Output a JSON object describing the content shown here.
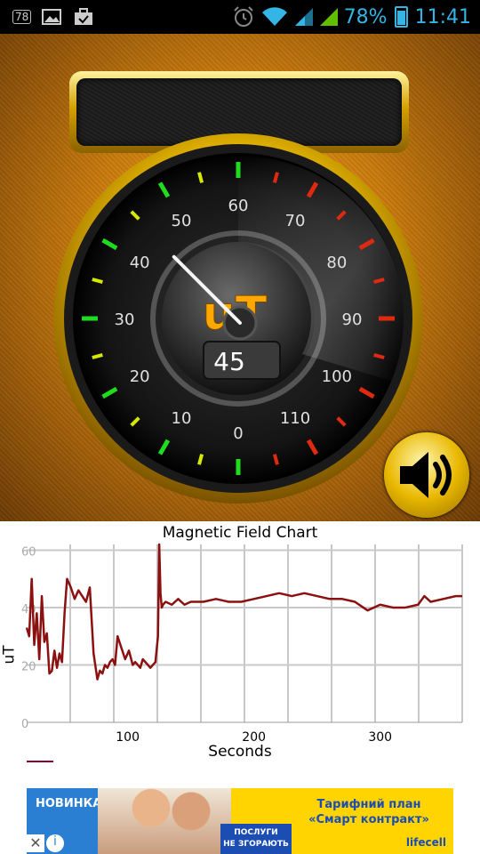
{
  "status_bar": {
    "notification_badge": "78",
    "battery_percent": "78%",
    "time": "11:41",
    "icons": [
      "image-icon",
      "briefcase-check-icon",
      "alarm-icon",
      "wifi-icon",
      "signal-icon",
      "signal-icon",
      "battery-icon"
    ]
  },
  "gauge": {
    "unit": "uT",
    "reading": "45",
    "needle_value": 45,
    "scale_min": 0,
    "scale_max": 110,
    "scale_labels": [
      "0",
      "10",
      "20",
      "30",
      "40",
      "50",
      "60",
      "70",
      "80",
      "90",
      "100",
      "110"
    ],
    "colors": {
      "green": "#1fdc1f",
      "yellow": "#d6e800",
      "red": "#e02a10",
      "unit_gold": "#ffa800"
    }
  },
  "speaker_button": {
    "icon": "speaker-volume-icon"
  },
  "chart": {
    "title": "Magnetic Field Chart",
    "xlabel": "Seconds",
    "ylabel": "uT"
  },
  "chart_data": {
    "type": "line",
    "title": "Magnetic Field Chart",
    "xlabel": "Seconds",
    "ylabel": "uT",
    "xlim": [
      20,
      365
    ],
    "ylim": [
      0,
      62
    ],
    "x_ticks": [
      100,
      200,
      300
    ],
    "y_ticks": [
      0,
      20,
      40,
      60
    ],
    "grid": true,
    "color": "#8b1010",
    "x": [
      20,
      22,
      24,
      26,
      28,
      30,
      32,
      34,
      36,
      38,
      40,
      42,
      44,
      46,
      48,
      50,
      52,
      55,
      58,
      61,
      64,
      67,
      70,
      73,
      76,
      78,
      80,
      82,
      84,
      86,
      88,
      90,
      92,
      95,
      98,
      101,
      104,
      106,
      108,
      110,
      112,
      114,
      116,
      118,
      120,
      122,
      124,
      125,
      126,
      127,
      128,
      130,
      135,
      140,
      145,
      150,
      160,
      170,
      180,
      190,
      200,
      210,
      220,
      230,
      240,
      250,
      260,
      270,
      280,
      290,
      300,
      310,
      320,
      330,
      335,
      340,
      350,
      360,
      365
    ],
    "y": [
      33,
      30,
      50,
      27,
      38,
      22,
      44,
      28,
      31,
      17,
      18,
      25,
      19,
      24,
      21,
      38,
      50,
      47,
      43,
      46,
      44,
      42,
      47,
      24,
      15,
      18,
      17,
      20,
      19,
      21,
      22,
      20,
      30,
      26,
      22,
      25,
      20,
      21,
      20,
      19,
      22,
      21,
      20,
      19,
      20,
      21,
      30,
      62,
      45,
      40,
      41,
      42,
      41,
      43,
      41,
      42,
      42,
      43,
      42,
      42,
      43,
      44,
      45,
      44,
      45,
      44,
      43,
      43,
      42,
      39,
      41,
      40,
      40,
      41,
      44,
      42,
      43,
      44,
      44
    ]
  },
  "ad": {
    "badge": "НОВИНКА",
    "service_line1": "ПОСЛУГИ",
    "service_line2": "НЕ ЗГОРАЮТЬ",
    "tariff_line1": "Тарифний план",
    "tariff_line2": "«Смарт контракт»",
    "brand": "lifecell",
    "close_symbol": "✕",
    "info_symbol": "i"
  }
}
